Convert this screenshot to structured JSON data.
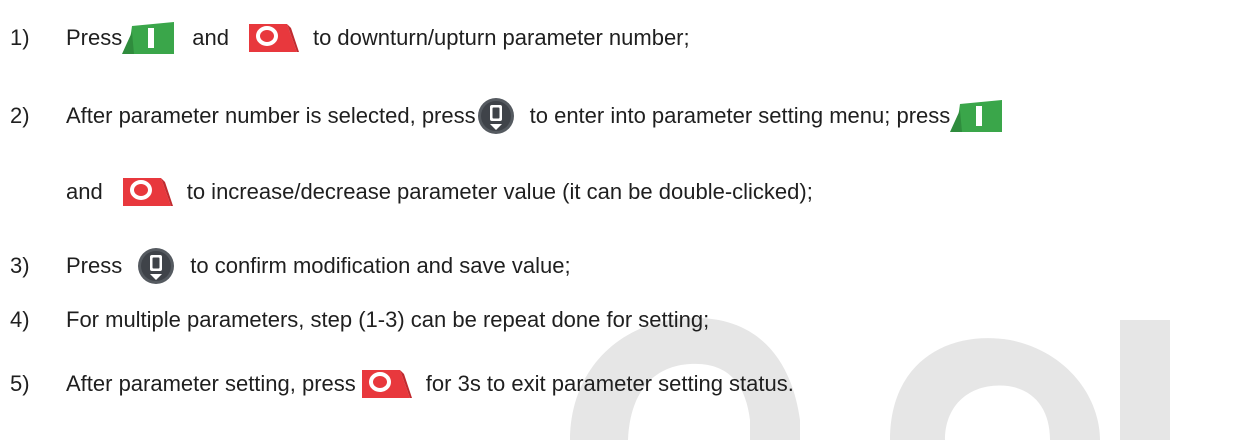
{
  "colors": {
    "green_key": "#3aa64a",
    "red_key": "#e8383d",
    "confirm_key": "#555a60",
    "watermark": "#e6e6e6"
  },
  "icons": {
    "green": "green-on-key-icon",
    "red": "red-off-key-icon",
    "confirm": "confirm-enter-key-icon"
  },
  "steps": [
    {
      "number": "1)",
      "text_a": "Press",
      "text_b": "and",
      "text_c": "to downturn/upturn parameter number;"
    },
    {
      "number": "2)",
      "text_a": "After parameter number is selected, press",
      "text_b": "to enter into parameter setting menu; press",
      "cont_a": "and",
      "cont_b": "to increase/decrease parameter value (it can be double-clicked);"
    },
    {
      "number": "3)",
      "text_a": "Press",
      "text_b": "to confirm modification and save value;"
    },
    {
      "number": "4)",
      "text_a": "For multiple parameters, step (1-3) can be repeat done for setting;"
    },
    {
      "number": "5)",
      "text_a": "After parameter setting, press",
      "text_b": "for 3s to exit parameter setting status."
    }
  ]
}
